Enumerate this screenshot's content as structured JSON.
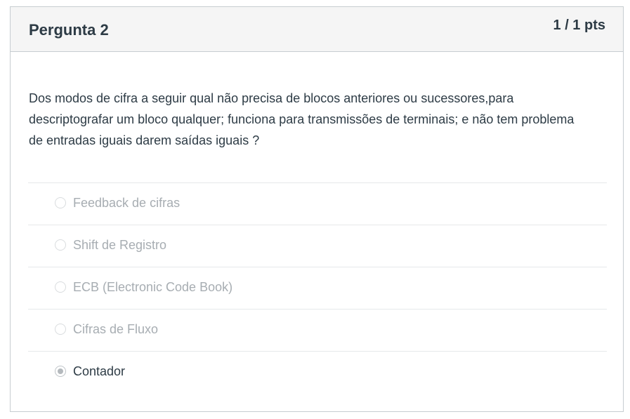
{
  "question": {
    "title": "Pergunta 2",
    "points": "1 / 1 pts",
    "text": "Dos modos de cifra a seguir qual não precisa de blocos anteriores ou sucessores,para descriptografar um bloco qualquer; funciona para transmissões de terminais; e não tem problema de entradas iguais darem saídas iguais ?"
  },
  "answers": [
    {
      "label": "Feedback de cifras",
      "selected": false
    },
    {
      "label": "Shift de Registro",
      "selected": false
    },
    {
      "label": "ECB (Electronic Code Book)",
      "selected": false
    },
    {
      "label": "Cifras de Fluxo",
      "selected": false
    },
    {
      "label": "Contador",
      "selected": true
    }
  ],
  "colors": {
    "text": "#2d3b45",
    "muted_text": "#a7adb2",
    "header_bg": "#f5f5f5",
    "border": "#c7cdd1"
  }
}
